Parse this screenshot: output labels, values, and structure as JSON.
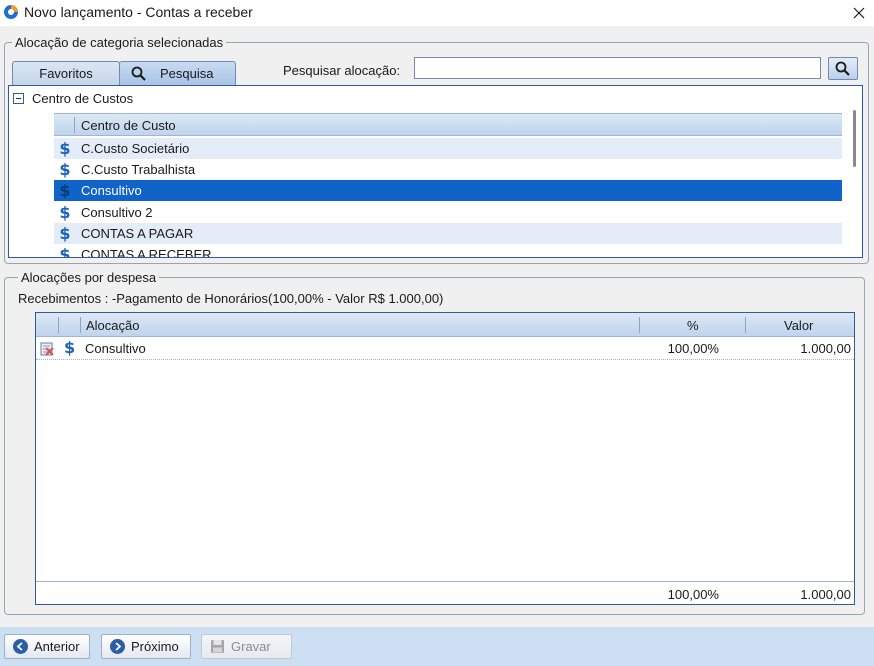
{
  "window": {
    "title": "Novo lançamento - Contas a receber"
  },
  "alloc_category": {
    "legend": "Alocação de categoria selecionadas",
    "tabs": [
      {
        "label": "Favoritos"
      },
      {
        "label": "Pesquisa"
      }
    ],
    "search_label": "Pesquisar alocação:",
    "search_value": "",
    "tree": {
      "root_label": "Centro de Custos",
      "column_header": "Centro de Custo",
      "rows": [
        {
          "label": "C.Custo Societário",
          "state": "alt"
        },
        {
          "label": "C.Custo Trabalhista",
          "state": "normal"
        },
        {
          "label": "Consultivo",
          "state": "selected"
        },
        {
          "label": "Consultivo 2",
          "state": "normal"
        },
        {
          "label": "CONTAS A PAGAR",
          "state": "alt"
        },
        {
          "label": "CONTAS A RECEBER",
          "state": "normal"
        }
      ]
    }
  },
  "alloc_expense": {
    "legend": "Alocações por despesa",
    "summary": "Recebimentos : -Pagamento de Honorários(100,00% - Valor R$ 1.000,00)",
    "columns": {
      "alocacao": "Alocação",
      "percent": "%",
      "valor": "Valor"
    },
    "rows": [
      {
        "name": "Consultivo",
        "percent": "100,00%",
        "valor": "1.000,00"
      }
    ],
    "totals": {
      "percent": "100,00%",
      "valor": "1.000,00"
    }
  },
  "footer": {
    "prev_label": "Anterior",
    "next_label": "Próximo",
    "save_label": "Gravar"
  },
  "colors": {
    "selection": "#0f63c9",
    "accent_border": "#2f5b98",
    "bottom_bar": "#cddff2"
  },
  "icons": [
    "app-icon",
    "close-icon",
    "magnifier-icon",
    "collapse-icon",
    "dollar-icon",
    "delete-row-icon",
    "arrow-left-icon",
    "arrow-right-icon",
    "floppy-disk-icon"
  ]
}
